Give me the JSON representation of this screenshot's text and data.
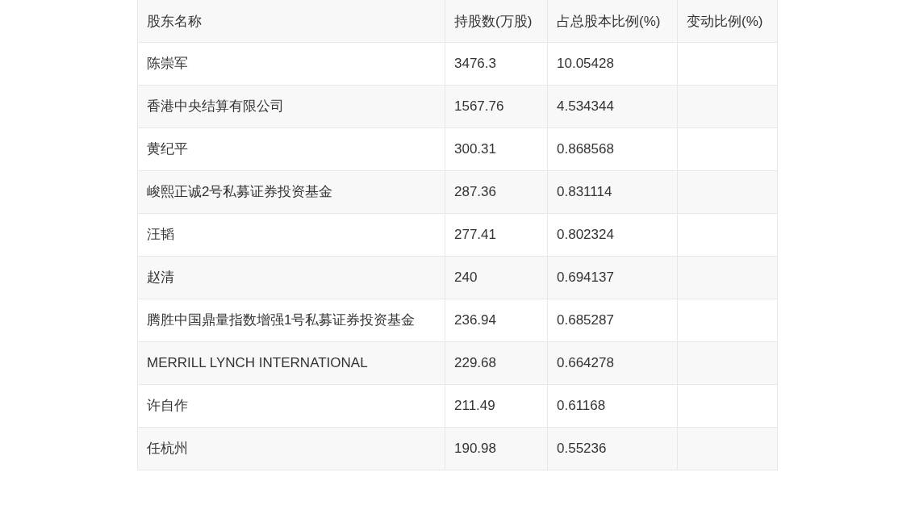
{
  "table": {
    "columns": [
      "股东名称",
      "持股数(万股)",
      "占总股本比例(%)",
      "变动比例(%)"
    ],
    "rows": [
      [
        "陈崇军",
        "3476.3",
        "10.05428"
      ],
      [
        "香港中央结算有限公司",
        "1567.76",
        "4.534344"
      ],
      [
        "黄纪平",
        "300.31",
        "0.868568"
      ],
      [
        "峻熙正诚2号私募证券投资基金",
        "287.36",
        "0.831114"
      ],
      [
        "汪韬",
        "277.41",
        "0.802324"
      ],
      [
        "赵清",
        "240",
        "0.694137"
      ],
      [
        "腾胜中国鼎量指数增强1号私募证券投资基金",
        "236.94",
        "0.685287"
      ],
      [
        "MERRILL LYNCH INTERNATIONAL",
        "229.68",
        "0.664278"
      ],
      [
        "许自作",
        "211.49",
        "0.61168"
      ],
      [
        "任杭州",
        "190.98",
        "0.55236"
      ]
    ]
  }
}
